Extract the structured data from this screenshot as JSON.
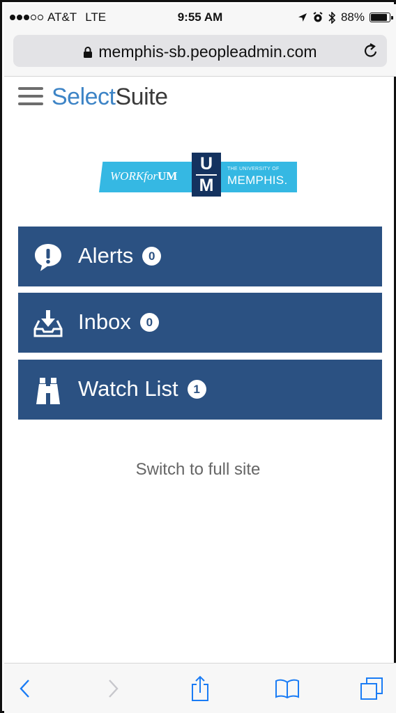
{
  "status_bar": {
    "signal_filled": 3,
    "signal_total": 5,
    "carrier": "AT&T",
    "network": "LTE",
    "time": "9:55 AM",
    "battery_percent": "88%",
    "battery_level": 0.88,
    "icons": [
      "location-arrow-icon",
      "alarm-icon",
      "bluetooth-icon",
      "battery-icon"
    ]
  },
  "browser": {
    "url": "memphis-sb.peopleadmin.com",
    "icons": [
      "lock-icon",
      "reload-icon"
    ]
  },
  "header": {
    "brand_part1": "Select",
    "brand_part2": "Suite",
    "menu_icon": "hamburger-menu-icon"
  },
  "logo": {
    "left_text_italic": "WORK",
    "left_text_italic2": "for",
    "left_text_bold": "UM",
    "mid_top": "U",
    "mid_bottom": "M",
    "right_small": "THE UNIVERSITY OF",
    "right_big": "MEMPHIS."
  },
  "menu": [
    {
      "label": "Alerts",
      "count": "0",
      "icon": "alert-speech-bubble-icon"
    },
    {
      "label": "Inbox",
      "count": "0",
      "icon": "inbox-tray-icon"
    },
    {
      "label": "Watch List",
      "count": "1",
      "icon": "binoculars-icon"
    }
  ],
  "switch_link": "Switch to full site",
  "toolbar": {
    "items": [
      "back-icon",
      "forward-icon",
      "share-icon",
      "bookmarks-icon",
      "tabs-icon"
    ]
  },
  "colors": {
    "tile_bg": "#2b5182",
    "brand_blue": "#3d84c6",
    "brand_dark": "#3a3a3a",
    "logo_cyan": "#35b8e3",
    "logo_navy": "#14325f",
    "ios_blue": "#1a7cf5"
  }
}
